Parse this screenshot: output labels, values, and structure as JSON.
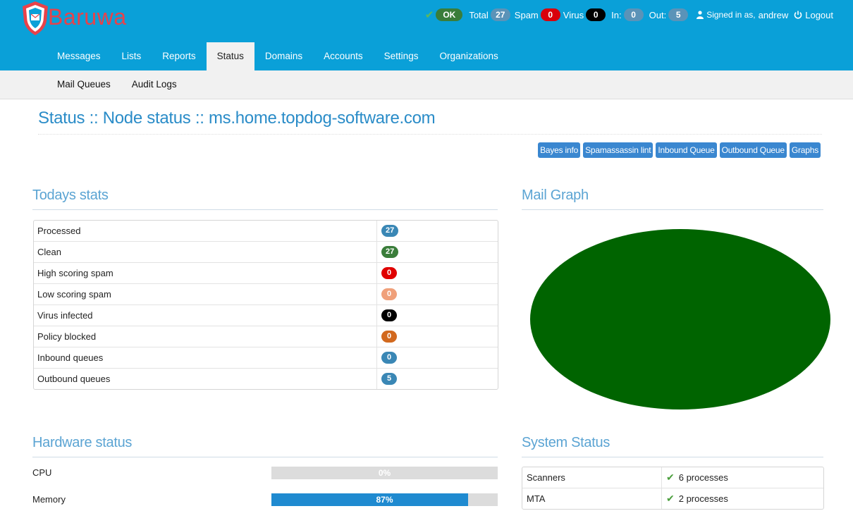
{
  "header": {
    "brand": "Baruwa",
    "status": {
      "ok_label": "OK",
      "total_label": "Total",
      "total_count": "27",
      "spam_label": "Spam",
      "spam_count": "0",
      "virus_label": "Virus",
      "virus_count": "0",
      "in_label": "In:",
      "in_count": "0",
      "out_label": "Out:",
      "out_count": "5"
    },
    "signed_in_prefix": "Signed in as,",
    "username": "andrew",
    "logout_label": "Logout"
  },
  "nav": {
    "items": [
      {
        "label": "Messages"
      },
      {
        "label": "Lists"
      },
      {
        "label": "Reports"
      },
      {
        "label": "Status"
      },
      {
        "label": "Domains"
      },
      {
        "label": "Accounts"
      },
      {
        "label": "Settings"
      },
      {
        "label": "Organizations"
      }
    ],
    "active": "Status"
  },
  "subnav": {
    "items": [
      {
        "label": "Mail Queues"
      },
      {
        "label": "Audit Logs"
      }
    ]
  },
  "page": {
    "title": "Status :: Node status :: ms.home.topdog-software.com"
  },
  "actions": [
    {
      "label": "Bayes info"
    },
    {
      "label": "Spamassassin lint"
    },
    {
      "label": "Inbound Queue"
    },
    {
      "label": "Outbound Queue"
    },
    {
      "label": "Graphs"
    }
  ],
  "todays_stats": {
    "title": "Todays stats",
    "rows": [
      {
        "label": "Processed",
        "value": "27",
        "color": "#3a87b5"
      },
      {
        "label": "Clean",
        "value": "27",
        "color": "#3a7d3a"
      },
      {
        "label": "High scoring spam",
        "value": "0",
        "color": "#e00000"
      },
      {
        "label": "Low scoring spam",
        "value": "0",
        "color": "#f0a07a"
      },
      {
        "label": "Virus infected",
        "value": "0",
        "color": "#000000"
      },
      {
        "label": "Policy blocked",
        "value": "0",
        "color": "#d2691e"
      },
      {
        "label": "Inbound queues",
        "value": "0",
        "color": "#3a87b5"
      },
      {
        "label": "Outbound queues",
        "value": "5",
        "color": "#3a87b5"
      }
    ]
  },
  "mail_graph": {
    "title": "Mail Graph",
    "color": "#006400"
  },
  "hardware": {
    "title": "Hardware status",
    "rows": [
      {
        "label": "CPU",
        "percent_text": "0%",
        "fraction": 0.0
      },
      {
        "label": "Memory",
        "percent_text": "87%",
        "fraction": 0.87
      }
    ]
  },
  "system_status": {
    "title": "System Status",
    "rows": [
      {
        "label": "Scanners",
        "value": "6 processes"
      },
      {
        "label": "MTA",
        "value": "2 processes"
      }
    ]
  }
}
